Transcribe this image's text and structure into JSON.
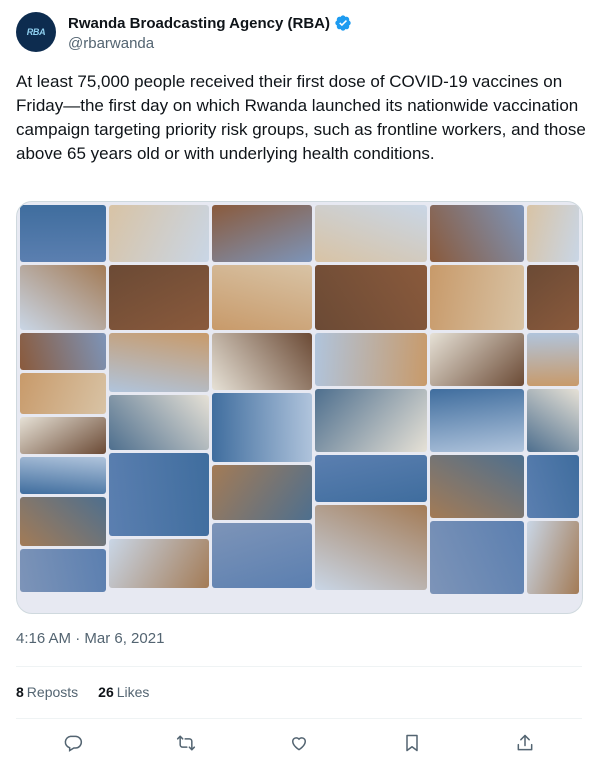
{
  "account": {
    "display_name": "Rwanda Broadcasting Agency (RBA)",
    "handle": "@rbarwanda",
    "avatar_text": "RBA",
    "verified_color": "#1d9bf0"
  },
  "tweet": {
    "text": "At least 75,000 people received their first dose of COVID-19 vaccines on Friday—the first day on which Rwanda launched its nationwide vaccination campaign targeting priority risk groups, such as frontline workers, and those above 65 years old or with underlying health conditions.",
    "timestamp": "4:16 AM · Mar 6, 2021"
  },
  "media": {
    "description_icon": "photo-collage",
    "palette": [
      "#5b7fb0",
      "#c9d6e6",
      "#8a5a3c",
      "#c89a6a",
      "#e6e1d6",
      "#3f6d9e",
      "#a37b56",
      "#7d94b8",
      "#d8c3a5",
      "#6b4a35",
      "#b0c4dc",
      "#4e6f8e"
    ]
  },
  "stats": {
    "reposts_count": "8",
    "reposts_label": "Reposts",
    "likes_count": "26",
    "likes_label": "Likes"
  },
  "actions": [
    "reply-icon",
    "repost-icon",
    "like-icon",
    "bookmark-icon",
    "share-icon"
  ],
  "colors": {
    "text_primary": "#0f1419",
    "text_secondary": "#536471",
    "divider": "#eff3f4"
  }
}
